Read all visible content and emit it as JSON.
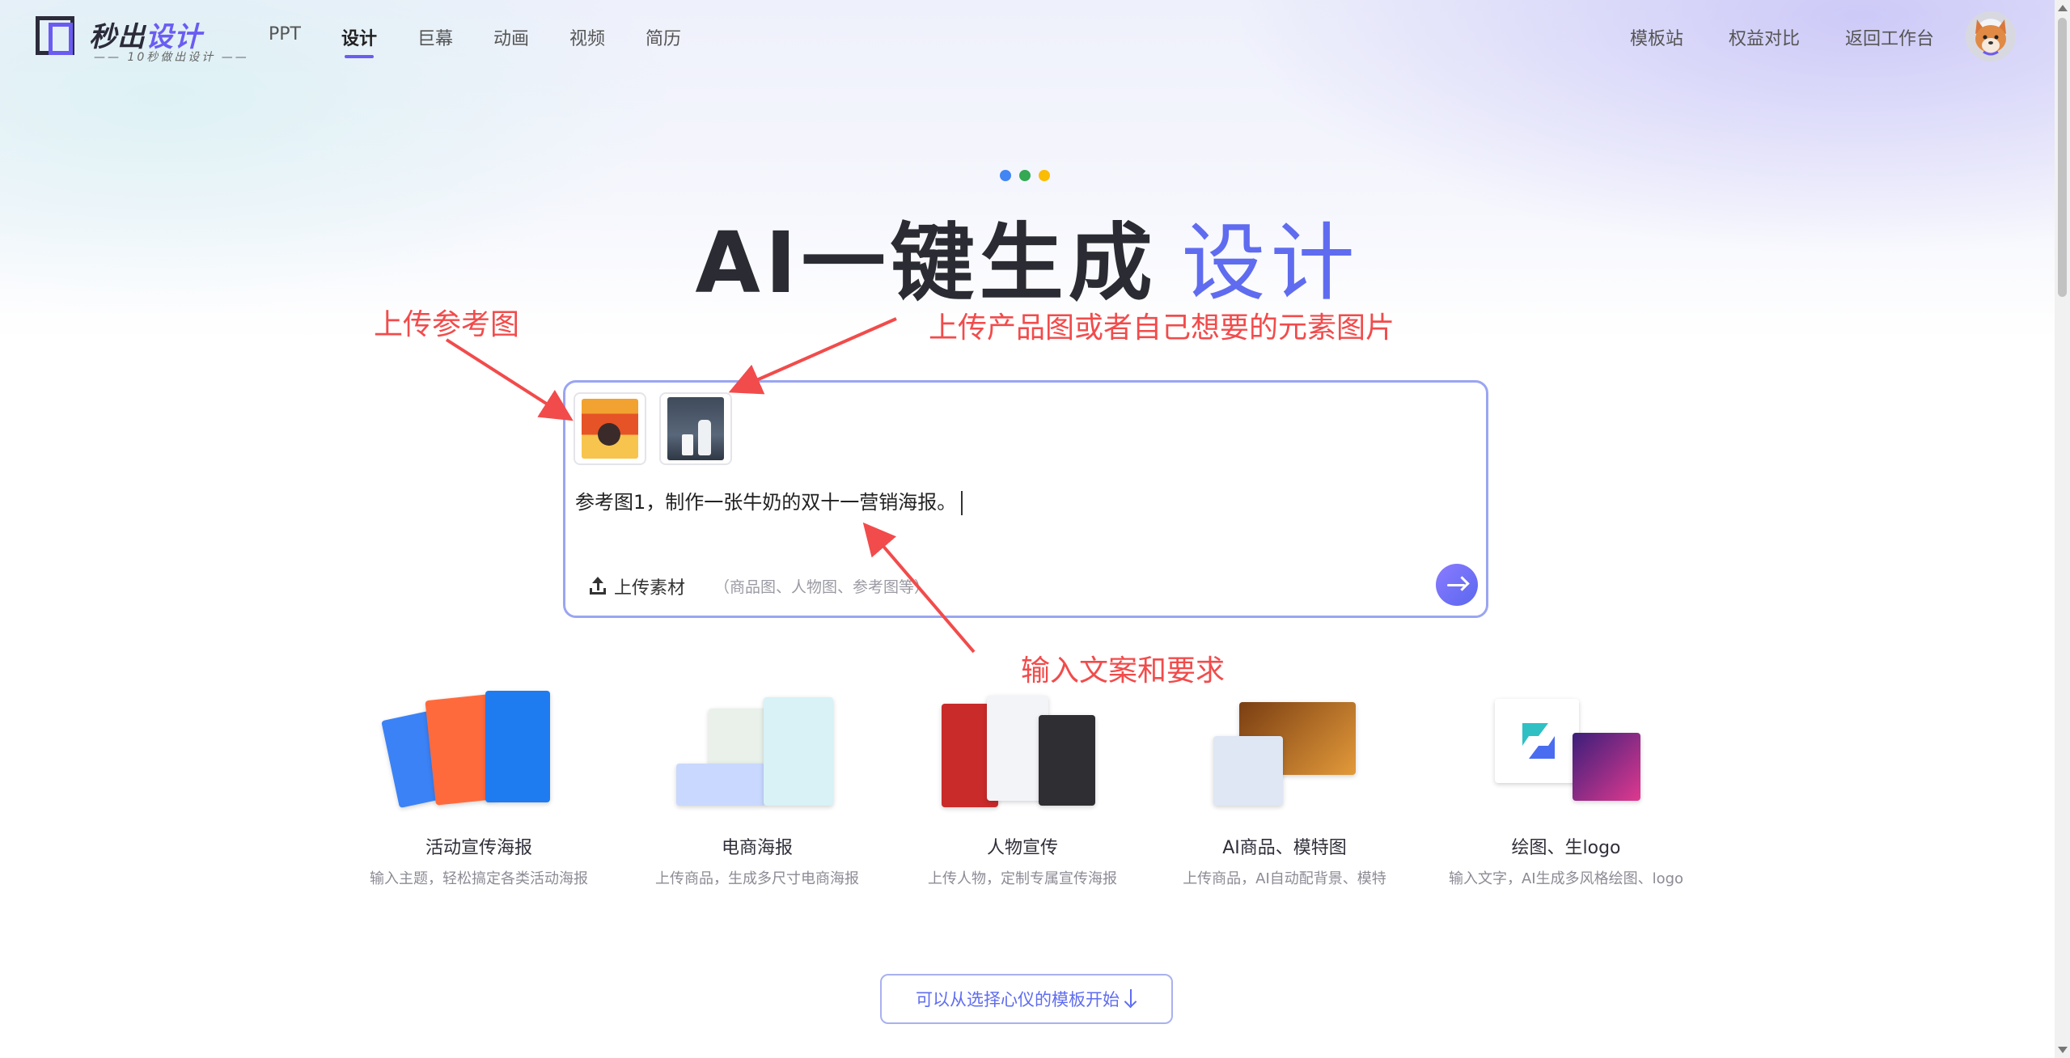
{
  "header": {
    "brand_part1": "秒出",
    "brand_part2": "设计",
    "slogan": "—— 10秒做出设计 ——",
    "nav": [
      "PPT",
      "设计",
      "巨幕",
      "动画",
      "视频",
      "简历"
    ],
    "active_nav": "设计",
    "right_nav": [
      "模板站",
      "权益对比",
      "返回工作台"
    ]
  },
  "hero": {
    "title_main": "AI一键生成",
    "title_accent": "设计",
    "dot_colors": [
      "#4285f4",
      "#34a853",
      "#fbbc05"
    ]
  },
  "annotations": {
    "upload_reference": "上传参考图",
    "upload_product": "上传产品图或者自己想要的元素图片",
    "input_copy": "输入文案和要求",
    "color": "#f24b4b"
  },
  "composer": {
    "prompt_text": "参考图1，制作一张牛奶的双十一营销海报。",
    "upload_label": "上传素材",
    "upload_hint": "（商品图、人物图、参考图等）",
    "accent_color": "#5f6cf0"
  },
  "features": [
    {
      "title": "活动宣传海报",
      "desc": "输入主题，轻松搞定各类活动海报"
    },
    {
      "title": "电商海报",
      "desc": "上传商品，生成多尺寸电商海报"
    },
    {
      "title": "人物宣传",
      "desc": "上传人物，定制专属宣传海报"
    },
    {
      "title": "AI商品、模特图",
      "desc": "上传商品，AI自动配背景、模特"
    },
    {
      "title": "绘图、生logo",
      "desc": "输入文字，AI生成多风格绘图、logo"
    }
  ],
  "template_button": {
    "label": "可以从选择心仪的模板开始"
  }
}
